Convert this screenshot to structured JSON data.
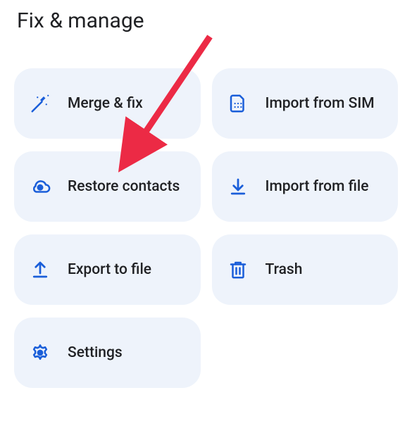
{
  "header": {
    "title": "Fix & manage"
  },
  "tiles": {
    "merge_fix": "Merge & fix",
    "import_sim": "Import from SIM",
    "restore_contacts": "Restore contacts",
    "import_file": "Import from file",
    "export_file": "Export to file",
    "trash": "Trash",
    "settings": "Settings"
  },
  "colors": {
    "tile_bg": "#eef3fb",
    "icon": "#1a5ed9",
    "text_primary": "#202124"
  },
  "annotation": {
    "arrow_target": "restore-contacts-button"
  }
}
